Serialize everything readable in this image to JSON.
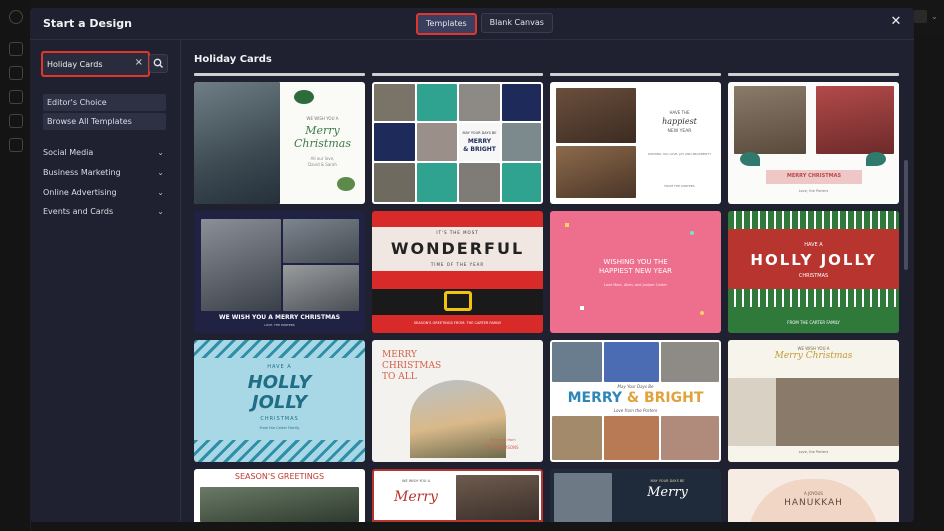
{
  "modal": {
    "title": "Start a Design",
    "tabs": [
      {
        "label": "Templates",
        "active": true
      },
      {
        "label": "Blank Canvas",
        "active": false
      }
    ]
  },
  "sidebar": {
    "search": {
      "value": "Holiday Cards",
      "placeholder": ""
    },
    "quick_links": [
      "Editor's Choice",
      "Browse All Templates"
    ],
    "categories": [
      "Social Media",
      "Business Marketing",
      "Online Advertising",
      "Events and Cards"
    ]
  },
  "main": {
    "section_title": "Holiday Cards",
    "cards": {
      "c1": {
        "line1": "WE WISH YOU A",
        "line2": "Merry",
        "line3": "Christmas",
        "line4": "All our love,",
        "line5": "David & Sarah"
      },
      "c2": {
        "line1": "MAY YOUR DAYS BE",
        "line2": "MERRY",
        "line3": "& BRIGHT"
      },
      "c3": {
        "line1": "HAVE THE",
        "line2": "happiest",
        "line3": "NEW YEAR",
        "line4": "WISHING YOU LOVE, JOY AND PROSPERITY",
        "line5": "FROM THE PORTERS"
      },
      "c4": {
        "line1": "MERRY CHRISTMAS",
        "line2": "Love, the Porters"
      },
      "c5": {
        "line1": "WE WISH YOU A MERRY CHRISTMAS",
        "line2": "LOVE, THE PORTERS"
      },
      "c6": {
        "line1": "IT'S THE MOST",
        "line2": "WONDERFUL",
        "line3": "TIME OF THE YEAR",
        "line4": "SEASON'S GREETINGS FROM: THE CARTER FAMILY"
      },
      "c7": {
        "line1": "WISHING YOU THE",
        "line2": "HAPPIEST NEW YEAR",
        "line3": "Love Marc, Allen, and Juniper Carter"
      },
      "c8": {
        "line1": "HAVE A",
        "line2": "HOLLY JOLLY",
        "line3": "CHRISTMAS",
        "line4": "FROM THE CARTER FAMILY"
      },
      "c9": {
        "line1": "HAVE A",
        "line2": "HOLLY",
        "line3": "JOLLY",
        "line4": "CHRISTMAS",
        "line5": "From the Carter Family"
      },
      "c10": {
        "line1": "MERRY",
        "line2": "CHRISTMAS",
        "line3": "TO ALL",
        "line4": "Blessings from",
        "line5": "THE ANDERSONS"
      },
      "c11": {
        "line1": "May Your Days Be",
        "line2": "MERRY",
        "line3": "& BRIGHT",
        "line4": "Love from the Porters"
      },
      "c12": {
        "line1": "WE WISH YOU A",
        "line2": "Merry Christmas",
        "line3": "Love, the Porters"
      },
      "c13": {
        "line1": "SEASON'S GREETINGS"
      },
      "c14": {
        "line1": "WE WISH YOU A",
        "line2": "Merry"
      },
      "c15": {
        "line1": "MAY YOUR DAYS BE",
        "line2": "Merry"
      },
      "c16": {
        "line1": "A JOYOUS",
        "line2": "HANUKKAH"
      }
    }
  },
  "colors": {
    "accent_red": "#e0362c",
    "modal_bg": "#1f2130",
    "tab_active_bg": "#3b3f5f"
  },
  "icons": {
    "search": "search-icon",
    "clear": "close-icon",
    "close": "close-icon",
    "chevron": "chevron-down-icon"
  }
}
